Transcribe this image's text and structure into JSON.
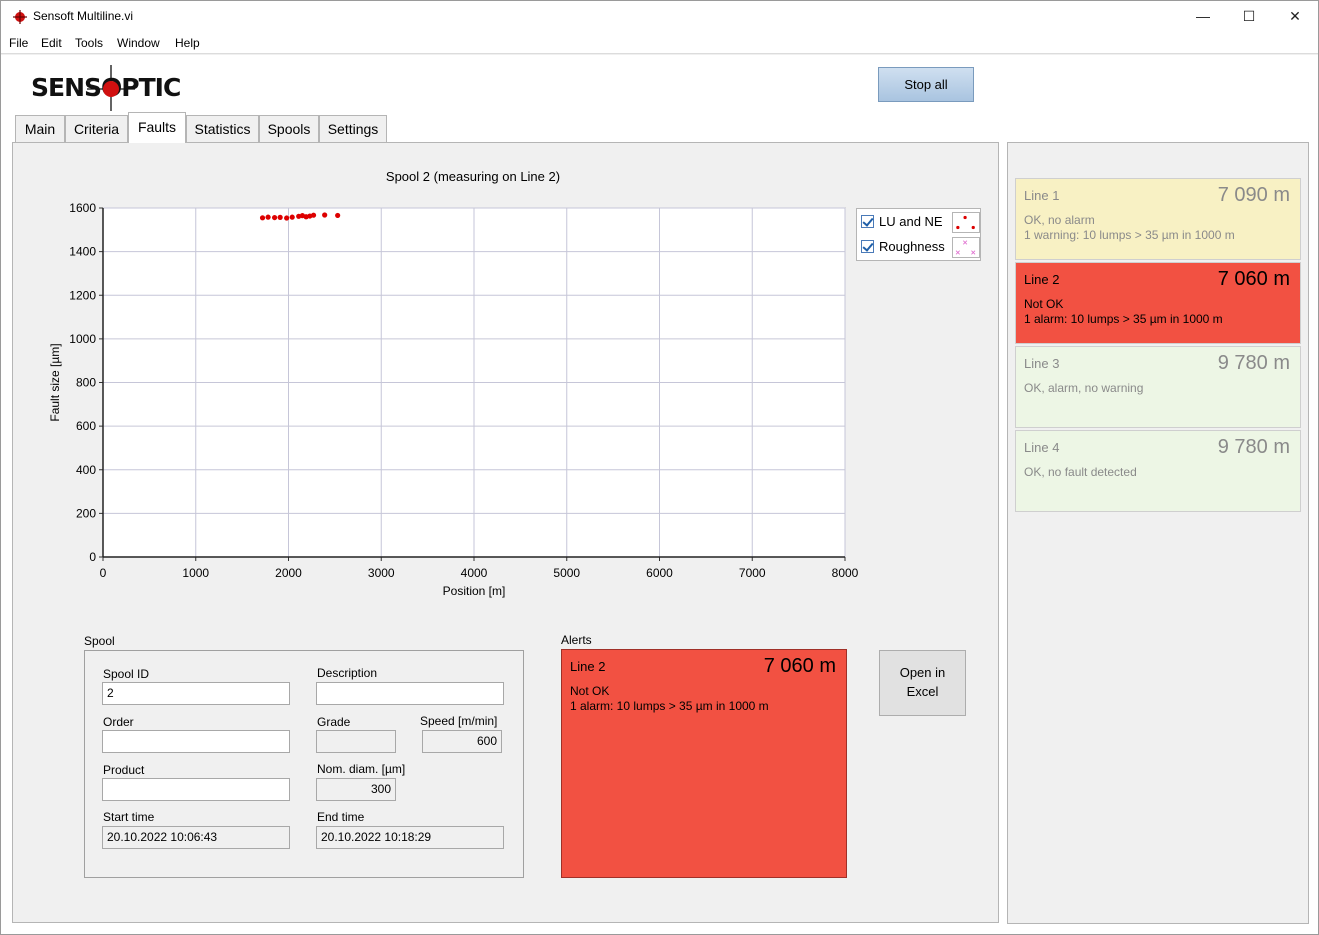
{
  "window": {
    "title": "Sensoft Multiline.vi",
    "minimize": "—",
    "maximize": "☐",
    "close": "✕"
  },
  "menu": [
    "File",
    "Edit",
    "Tools",
    "Window",
    "Help"
  ],
  "logo": {
    "text": "SENSOPTIC"
  },
  "toolbar": {
    "stop_all": "Stop all"
  },
  "tabs": [
    {
      "label": "Main"
    },
    {
      "label": "Criteria"
    },
    {
      "label": "Faults"
    },
    {
      "label": "Statistics"
    },
    {
      "label": "Spools"
    },
    {
      "label": "Settings"
    }
  ],
  "active_tab": "Faults",
  "chart": {
    "title": "Spool 2 (measuring on Line 2)"
  },
  "chart_data": {
    "type": "scatter",
    "title": "Spool 2 (measuring on Line 2)",
    "xlabel": "Position [m]",
    "ylabel": "Fault size [µm]",
    "xlim": [
      0,
      8000
    ],
    "ylim": [
      0,
      1600
    ],
    "xticks": [
      0,
      1000,
      2000,
      3000,
      4000,
      5000,
      6000,
      7000,
      8000
    ],
    "yticks": [
      0,
      200,
      400,
      600,
      800,
      1000,
      1200,
      1400,
      1600
    ],
    "grid": true,
    "legend_placement": "right",
    "series": [
      {
        "name": "LU and NE",
        "color": "#dd0000",
        "marker": "dot",
        "x": [
          1720,
          1780,
          1850,
          1910,
          1980,
          2040,
          2110,
          2150,
          2190,
          2230,
          2270,
          2390,
          2530
        ],
        "y": [
          1555,
          1558,
          1556,
          1557,
          1554,
          1558,
          1562,
          1565,
          1560,
          1563,
          1567,
          1568,
          1566
        ]
      },
      {
        "name": "Roughness",
        "color": "#e070d0",
        "marker": "x",
        "x": [],
        "y": []
      }
    ]
  },
  "legend": [
    {
      "label": "LU and NE",
      "checked": true
    },
    {
      "label": "Roughness",
      "checked": true
    }
  ],
  "spool": {
    "group_label": "Spool",
    "spool_id_label": "Spool ID",
    "spool_id": "2",
    "description_label": "Description",
    "description": "",
    "order_label": "Order",
    "order": "",
    "grade_label": "Grade",
    "grade": "",
    "speed_label": "Speed [m/min]",
    "speed": "600",
    "product_label": "Product",
    "product": "",
    "nom_diam_label": "Nom. diam. [µm]",
    "nom_diam": "300",
    "start_time_label": "Start time",
    "start_time": "20.10.2022 10:06:43",
    "end_time_label": "End time",
    "end_time": "20.10.2022 10:18:29"
  },
  "alerts": {
    "group_label": "Alerts",
    "line": "Line 2",
    "distance": "7 060 m",
    "status": "Not OK",
    "detail": "1 alarm: 10 lumps > 35 µm in 1000 m",
    "color": "#f25142"
  },
  "excel_button": {
    "line1": "Open in",
    "line2": "Excel"
  },
  "lines": [
    {
      "name": "Line 1",
      "distance": "7 090 m",
      "status": "OK, no alarm",
      "detail": "1 warning: 10 lumps > 35 µm in 1000 m",
      "bg": "#f8f1c4",
      "fg": "#8a8a8a",
      "dist_fg": "#8a8a8a"
    },
    {
      "name": "Line 2",
      "distance": "7 060 m",
      "status": "Not OK",
      "detail": "1 alarm: 10 lumps > 35 µm in 1000 m",
      "bg": "#f25142",
      "fg": "#000000",
      "dist_fg": "#000000"
    },
    {
      "name": "Line 3",
      "distance": "9 780 m",
      "status": "OK, alarm, no warning",
      "detail": "",
      "bg": "#edf6e5",
      "fg": "#8a8a8a",
      "dist_fg": "#8a8a8a"
    },
    {
      "name": "Line 4",
      "distance": "9 780 m",
      "status": "OK, no fault detected",
      "detail": "",
      "bg": "#edf6e5",
      "fg": "#8a8a8a",
      "dist_fg": "#8a8a8a"
    }
  ]
}
